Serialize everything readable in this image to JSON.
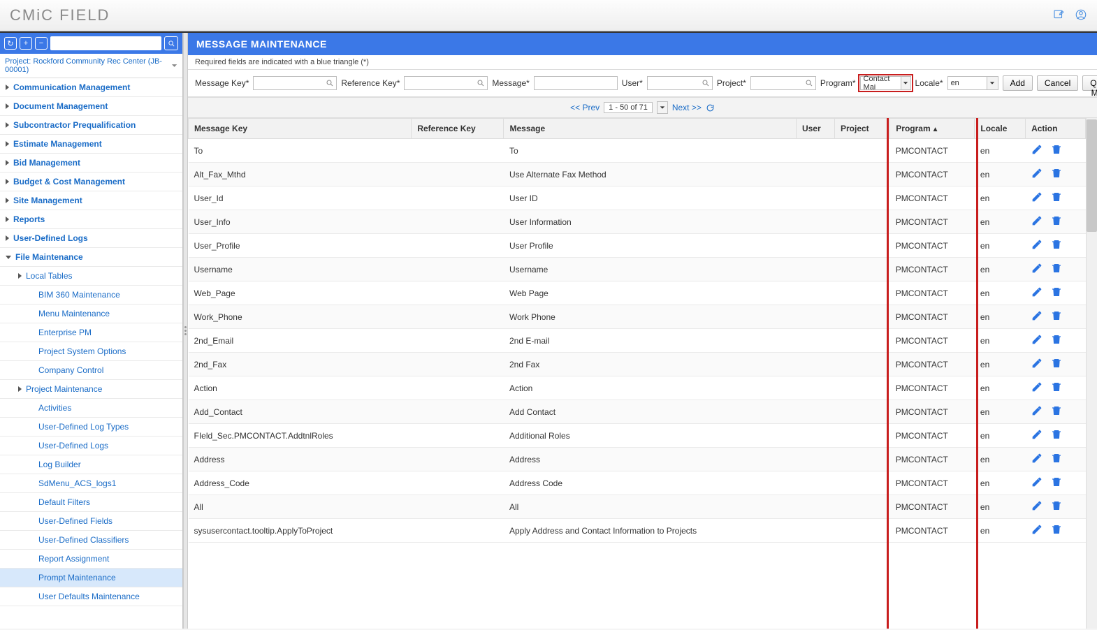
{
  "app_title": "CMiC FIELD",
  "project_line": "Project: Rockford Community Rec Center (JB-00001)",
  "sidebar": {
    "items": [
      {
        "label": "Communication Management",
        "level": 1,
        "arrow": "closed"
      },
      {
        "label": "Document Management",
        "level": 1,
        "arrow": "closed"
      },
      {
        "label": "Subcontractor Prequalification",
        "level": 1,
        "arrow": "closed"
      },
      {
        "label": "Estimate Management",
        "level": 1,
        "arrow": "closed"
      },
      {
        "label": "Bid Management",
        "level": 1,
        "arrow": "closed"
      },
      {
        "label": "Budget & Cost Management",
        "level": 1,
        "arrow": "closed"
      },
      {
        "label": "Site Management",
        "level": 1,
        "arrow": "closed"
      },
      {
        "label": "Reports",
        "level": 1,
        "arrow": "closed"
      },
      {
        "label": "User-Defined Logs",
        "level": 1,
        "arrow": "closed"
      },
      {
        "label": "File Maintenance",
        "level": 1,
        "arrow": "open"
      },
      {
        "label": "Local Tables",
        "level": 2,
        "arrow": "closed"
      },
      {
        "label": "BIM 360 Maintenance",
        "level": 3,
        "arrow": "none"
      },
      {
        "label": "Menu Maintenance",
        "level": 3,
        "arrow": "none"
      },
      {
        "label": "Enterprise PM",
        "level": 3,
        "arrow": "none"
      },
      {
        "label": "Project System Options",
        "level": 3,
        "arrow": "none"
      },
      {
        "label": "Company Control",
        "level": 3,
        "arrow": "none"
      },
      {
        "label": "Project Maintenance",
        "level": 2,
        "arrow": "closed"
      },
      {
        "label": "Activities",
        "level": 3,
        "arrow": "none"
      },
      {
        "label": "User-Defined Log Types",
        "level": 3,
        "arrow": "none"
      },
      {
        "label": "User-Defined Logs",
        "level": 3,
        "arrow": "none"
      },
      {
        "label": "Log Builder",
        "level": 3,
        "arrow": "none"
      },
      {
        "label": "SdMenu_ACS_logs1",
        "level": 3,
        "arrow": "none"
      },
      {
        "label": "Default Filters",
        "level": 3,
        "arrow": "none"
      },
      {
        "label": "User-Defined Fields",
        "level": 3,
        "arrow": "none"
      },
      {
        "label": "User-Defined Classifiers",
        "level": 3,
        "arrow": "none"
      },
      {
        "label": "Report Assignment",
        "level": 3,
        "arrow": "none"
      },
      {
        "label": "Prompt Maintenance",
        "level": 3,
        "arrow": "none",
        "selected": true
      },
      {
        "label": "User Defaults Maintenance",
        "level": 3,
        "arrow": "none"
      }
    ]
  },
  "panel": {
    "title": "MESSAGE MAINTENANCE",
    "required_hint": "Required fields are indicated with a blue triangle (*)",
    "filters": {
      "msgkey_label": "Message Key*",
      "refkey_label": "Reference Key*",
      "message_label": "Message*",
      "user_label": "User*",
      "project_label": "Project*",
      "program_label": "Program*",
      "program_value": "Contact Mai",
      "locale_label": "Locale*",
      "locale_value": "en"
    },
    "buttons": {
      "add": "Add",
      "cancel": "Cancel",
      "query": "Query Mode"
    },
    "pager": {
      "prev": "<< Prev",
      "range": "1 - 50 of 71",
      "next": "Next >>"
    },
    "columns": {
      "msgkey": "Message Key",
      "refkey": "Reference Key",
      "msg": "Message",
      "user": "User",
      "proj": "Project",
      "prog": "Program",
      "prog_sort": "▲",
      "loc": "Locale",
      "act": "Action"
    },
    "rows": [
      {
        "key": "To",
        "msg": "To",
        "prog": "PMCONTACT",
        "loc": "en"
      },
      {
        "key": "Alt_Fax_Mthd",
        "msg": "Use Alternate Fax Method",
        "prog": "PMCONTACT",
        "loc": "en"
      },
      {
        "key": "User_Id",
        "msg": "User ID",
        "prog": "PMCONTACT",
        "loc": "en"
      },
      {
        "key": "User_Info",
        "msg": "User Information",
        "prog": "PMCONTACT",
        "loc": "en"
      },
      {
        "key": "User_Profile",
        "msg": "User Profile",
        "prog": "PMCONTACT",
        "loc": "en"
      },
      {
        "key": "Username",
        "msg": "Username",
        "prog": "PMCONTACT",
        "loc": "en"
      },
      {
        "key": "Web_Page",
        "msg": "Web Page",
        "prog": "PMCONTACT",
        "loc": "en"
      },
      {
        "key": "Work_Phone",
        "msg": "Work Phone",
        "prog": "PMCONTACT",
        "loc": "en"
      },
      {
        "key": "2nd_Email",
        "msg": "2nd E-mail",
        "prog": "PMCONTACT",
        "loc": "en"
      },
      {
        "key": "2nd_Fax",
        "msg": "2nd Fax",
        "prog": "PMCONTACT",
        "loc": "en"
      },
      {
        "key": "Action",
        "msg": "Action",
        "prog": "PMCONTACT",
        "loc": "en"
      },
      {
        "key": "Add_Contact",
        "msg": "Add Contact",
        "prog": "PMCONTACT",
        "loc": "en"
      },
      {
        "key": "FIeld_Sec.PMCONTACT.AddtnlRoles",
        "msg": "Additional Roles",
        "prog": "PMCONTACT",
        "loc": "en"
      },
      {
        "key": "Address",
        "msg": "Address",
        "prog": "PMCONTACT",
        "loc": "en"
      },
      {
        "key": "Address_Code",
        "msg": "Address Code",
        "prog": "PMCONTACT",
        "loc": "en"
      },
      {
        "key": "All",
        "msg": "All",
        "prog": "PMCONTACT",
        "loc": "en"
      },
      {
        "key": "sysusercontact.tooltip.ApplyToProject",
        "msg": "Apply Address and Contact Information to Projects",
        "prog": "PMCONTACT",
        "loc": "en"
      }
    ]
  }
}
